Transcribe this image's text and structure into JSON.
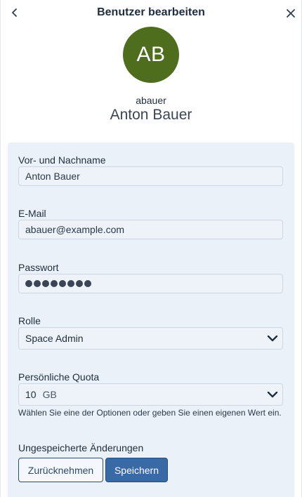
{
  "header": {
    "title": "Benutzer bearbeiten",
    "back_icon": "chevron-left-icon",
    "close_icon": "close-icon"
  },
  "user": {
    "initials": "AB",
    "avatar_color": "#4e6e1e",
    "username": "abauer",
    "display_name": "Anton Bauer"
  },
  "form": {
    "name_label": "Vor- und Nachname",
    "name_value": "Anton Bauer",
    "email_label": "E-Mail",
    "email_value": "abauer@example.com",
    "password_label": "Passwort",
    "password_mask_count": 8,
    "role_label": "Rolle",
    "role_value": "Space Admin",
    "quota_label": "Persönliche Quota",
    "quota_amount": "10",
    "quota_unit": "GB",
    "quota_hint": "Wählen Sie eine der Optionen oder geben Sie einen eigenen Wert ein."
  },
  "footer": {
    "unsaved_label": "Ungespeicherte Änderungen",
    "revert_label": "Zurücknehmen",
    "save_label": "Speichern"
  },
  "colors": {
    "card_bg": "#ebf1f8",
    "primary": "#3a6aa6"
  }
}
